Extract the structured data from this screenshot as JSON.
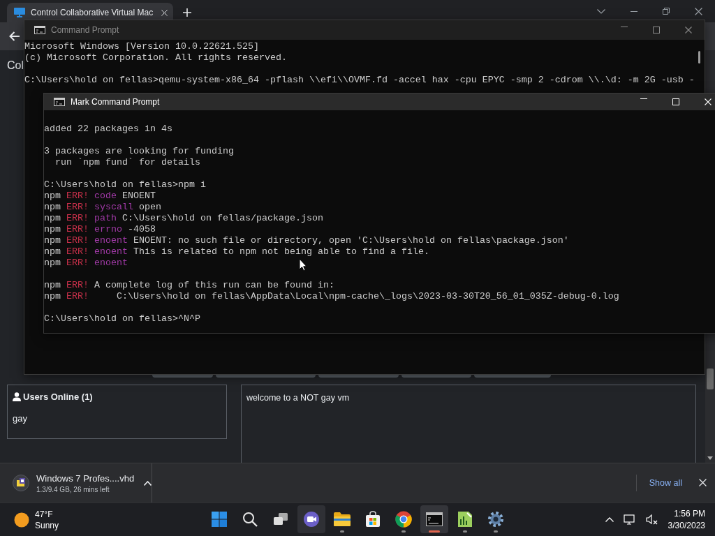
{
  "browser": {
    "tab": {
      "title": "Control Collaborative Virtual Mac"
    }
  },
  "page": {
    "heading": "Col",
    "users_panel": {
      "title": "Users Online (1)",
      "users": [
        "gay"
      ]
    },
    "chat": {
      "messages": [
        "welcome to a NOT gay vm"
      ]
    }
  },
  "windows": [
    {
      "title": "Command Prompt",
      "active": false,
      "blocks": [
        [
          "Microsoft Windows [Version 10.0.22621.525]",
          "(c) Microsoft Corporation. All rights reserved."
        ],
        [
          "C:\\Users\\hold on fellas>qemu-system-x86_64 -pflash \\\\efi\\\\OVMF.fd -accel hax -cpu EPYC -smp 2 -cdrom \\\\.\\d: -m 2G -usb -"
        ]
      ]
    },
    {
      "title": "Mark Command Prompt",
      "active": true,
      "blocks": [
        [
          "added 22 packages in 4s"
        ],
        [
          "3 packages are looking for funding",
          "  run `npm fund` for details"
        ],
        [
          "C:\\Users\\hold on fellas>npm i",
          [
            {
              "kind": "plain",
              "text": "npm "
            },
            {
              "kind": "error",
              "text": "ERR! "
            },
            {
              "kind": "key",
              "text": "code"
            },
            {
              "kind": "plain",
              "text": " ENOENT"
            }
          ],
          [
            {
              "kind": "plain",
              "text": "npm "
            },
            {
              "kind": "error",
              "text": "ERR! "
            },
            {
              "kind": "key",
              "text": "syscall"
            },
            {
              "kind": "plain",
              "text": " open"
            }
          ],
          [
            {
              "kind": "plain",
              "text": "npm "
            },
            {
              "kind": "error",
              "text": "ERR! "
            },
            {
              "kind": "key",
              "text": "path"
            },
            {
              "kind": "plain",
              "text": " C:\\Users\\hold on fellas/package.json"
            }
          ],
          [
            {
              "kind": "plain",
              "text": "npm "
            },
            {
              "kind": "error",
              "text": "ERR! "
            },
            {
              "kind": "key",
              "text": "errno"
            },
            {
              "kind": "plain",
              "text": " -4058"
            }
          ],
          [
            {
              "kind": "plain",
              "text": "npm "
            },
            {
              "kind": "error",
              "text": "ERR! "
            },
            {
              "kind": "key",
              "text": "enoent"
            },
            {
              "kind": "plain",
              "text": " ENOENT: no such file or directory, open 'C:\\Users\\hold on fellas\\package.json'"
            }
          ],
          [
            {
              "kind": "plain",
              "text": "npm "
            },
            {
              "kind": "error",
              "text": "ERR! "
            },
            {
              "kind": "key",
              "text": "enoent"
            },
            {
              "kind": "plain",
              "text": " This is related to npm not being able to find a file."
            }
          ],
          [
            {
              "kind": "plain",
              "text": "npm "
            },
            {
              "kind": "error",
              "text": "ERR! "
            },
            {
              "kind": "key",
              "text": "enoent"
            }
          ]
        ],
        [
          [
            {
              "kind": "plain",
              "text": "npm "
            },
            {
              "kind": "error",
              "text": "ERR! "
            },
            {
              "kind": "plain",
              "text": "A complete log of this run can be found in:"
            }
          ],
          [
            {
              "kind": "plain",
              "text": "npm "
            },
            {
              "kind": "error",
              "text": "ERR! "
            },
            {
              "kind": "plain",
              "text": "    C:\\Users\\hold on fellas\\AppData\\Local\\npm-cache\\_logs\\2023-03-30T20_56_01_035Z-debug-0.log"
            }
          ]
        ],
        [
          "C:\\Users\\hold on fellas>^N^P"
        ]
      ]
    }
  ],
  "downloads": {
    "items": [
      {
        "name": "Windows 7 Profes....vhd",
        "status": "1.3/9.4 GB, 26 mins left"
      }
    ],
    "show_all": "Show all"
  },
  "taskbar": {
    "weather": {
      "temperature": "47°F",
      "condition": "Sunny"
    },
    "apps": [
      {
        "kind": "start",
        "running": false,
        "selected": false,
        "hovered": false
      },
      {
        "kind": "search",
        "running": false,
        "selected": false,
        "hovered": false
      },
      {
        "kind": "taskview",
        "running": false,
        "selected": false,
        "hovered": false
      },
      {
        "kind": "video",
        "running": false,
        "selected": false,
        "hovered": true
      },
      {
        "kind": "folder",
        "running": true,
        "selected": false,
        "hovered": false
      },
      {
        "kind": "store",
        "running": false,
        "selected": false,
        "hovered": false
      },
      {
        "kind": "browser",
        "running": true,
        "selected": false,
        "hovered": false
      },
      {
        "kind": "terminal",
        "running": true,
        "selected": true,
        "hovered": false
      },
      {
        "kind": "chartdoc",
        "running": true,
        "selected": false,
        "hovered": false
      },
      {
        "kind": "settings",
        "running": true,
        "selected": false,
        "hovered": false
      }
    ],
    "time": "1:56 PM",
    "date": "3/30/2023"
  }
}
